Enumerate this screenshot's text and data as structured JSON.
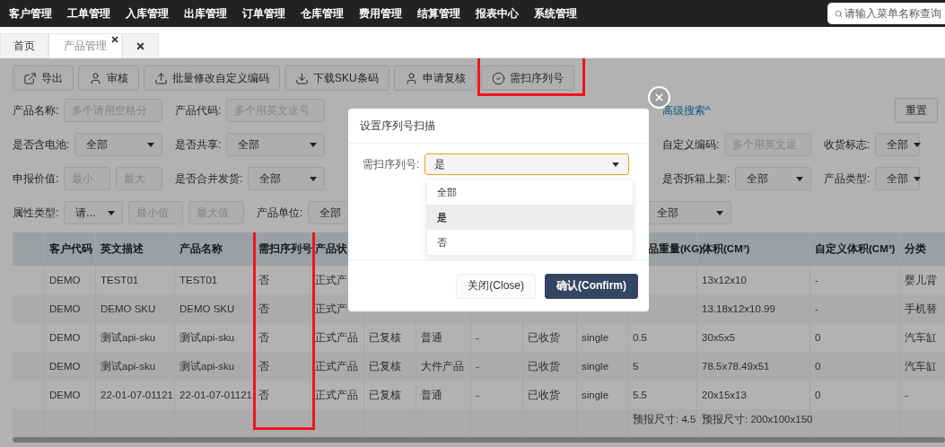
{
  "nav": {
    "items": [
      "客户管理",
      "工单管理",
      "入库管理",
      "出库管理",
      "订单管理",
      "仓库管理",
      "费用管理",
      "结算管理",
      "报表中心",
      "系统管理"
    ],
    "search": {
      "placeholder": "请输入菜单名称查询"
    }
  },
  "tabs": [
    {
      "kind": "page",
      "label": "首页",
      "selected": false,
      "closable": false
    },
    {
      "kind": "page",
      "label": "产品管理",
      "selected": true,
      "closable": true
    },
    {
      "kind": "close_all",
      "selected": false
    }
  ],
  "toolbar": [
    {
      "label": "导出",
      "highlighted": false
    },
    {
      "label": "审核",
      "highlighted": false
    },
    {
      "label": "批量修改自定义编码",
      "highlighted": false
    },
    {
      "label": "下载SKU条码",
      "highlighted": false
    },
    {
      "label": "申请复核",
      "highlighted": false
    },
    {
      "label": "需扫序列号",
      "highlighted": true
    }
  ],
  "filters": [
    [
      {
        "kind": "field",
        "label": "产品名称:",
        "controls": [
          {
            "kind": "input",
            "placeholder": "多个请用空格分"
          }
        ]
      },
      {
        "kind": "field",
        "label": "产品代码:",
        "controls": [
          {
            "kind": "input",
            "placeholder": "多个用英文逗号"
          }
        ]
      },
      {
        "kind": "link",
        "text": "高级搜索^"
      },
      {
        "kind": "button",
        "text": "重置"
      }
    ],
    [
      {
        "kind": "field",
        "label": "是否含电池:",
        "controls": [
          {
            "kind": "select",
            "value": "全部"
          }
        ]
      },
      {
        "kind": "field",
        "label": "是否共享:",
        "controls": [
          {
            "kind": "select",
            "value": "全部"
          }
        ]
      },
      {
        "kind": "field",
        "label": "自定义编码:",
        "controls": [
          {
            "kind": "input",
            "placeholder": "多个用英文逗"
          }
        ]
      },
      {
        "kind": "field",
        "label": "收货标志:",
        "controls": [
          {
            "kind": "select",
            "value": "全部"
          }
        ]
      }
    ],
    [
      {
        "kind": "field",
        "label": "申报价值:",
        "controls": [
          {
            "kind": "input",
            "placeholder": "最小"
          },
          {
            "kind": "input",
            "placeholder": "最大"
          }
        ]
      },
      {
        "kind": "field",
        "label": "是否合并发货:",
        "controls": [
          {
            "kind": "select",
            "value": "全部"
          }
        ]
      },
      {
        "kind": "field",
        "label": "是否拆箱上架:",
        "controls": [
          {
            "kind": "select",
            "value": "全部"
          }
        ]
      },
      {
        "kind": "field",
        "label": "产品类型:",
        "controls": [
          {
            "kind": "select",
            "value": "全部"
          }
        ]
      }
    ],
    [
      {
        "kind": "field",
        "label": "属性类型:",
        "controls": [
          {
            "kind": "select",
            "value": "请..."
          },
          {
            "kind": "input",
            "placeholder": "最小值"
          },
          {
            "kind": "input",
            "placeholder": "最大值"
          }
        ]
      },
      {
        "kind": "field",
        "label": "产品单位:",
        "controls": [
          {
            "kind": "select",
            "value": "全部"
          }
        ]
      },
      {
        "kind": "field",
        "controls": [
          {
            "kind": "select",
            "value": "全部"
          }
        ]
      }
    ]
  ],
  "table": {
    "columns": [
      {
        "label": "客户代码",
        "highlighted": false
      },
      {
        "label": "英文描述",
        "highlighted": false
      },
      {
        "label": "产品名称",
        "highlighted": false
      },
      {
        "label": "需扫序列号",
        "highlighted": true
      },
      {
        "label": "产品状",
        "highlighted": false
      },
      null,
      null,
      null,
      null,
      null,
      {
        "label": "品重量(KG)",
        "highlighted": false
      },
      {
        "label": "体积(CM³)",
        "highlighted": false
      },
      {
        "label": "自定义体积(CM³)",
        "highlighted": false
      },
      {
        "label": "分类",
        "highlighted": false
      }
    ],
    "rows": [
      [
        "DEMO",
        "TEST01",
        "TEST01",
        "否",
        "正式产",
        null,
        null,
        null,
        null,
        null,
        null,
        "13x12x10",
        "-",
        "婴儿背"
      ],
      [
        "DEMO",
        "DEMO SKU",
        "DEMO SKU",
        "否",
        "正式产",
        null,
        null,
        null,
        null,
        null,
        null,
        "13.18x12x10.99",
        "-",
        "手机替"
      ],
      [
        "DEMO",
        "测试api-sku",
        "测试api-sku",
        "否",
        "正式产品",
        "已复核",
        "普通",
        "-",
        "已收货",
        "single",
        "0.5",
        "30x5x5",
        "0",
        "汽车缸"
      ],
      [
        "DEMO",
        "测试api-sku",
        "测试api-sku",
        "否",
        "正式产品",
        "已复核",
        "大件产品",
        "-",
        "已收货",
        "single",
        "5",
        "78.5x78.49x51",
        "0",
        "汽车缸"
      ],
      [
        "DEMO",
        "22-01-07-01121",
        "22-01-07-01121",
        "否",
        "正式产品",
        "已复核",
        "普通",
        "-",
        "已收货",
        "single",
        "5.5",
        "20x15x13",
        "0",
        "-"
      ],
      [
        null,
        null,
        null,
        null,
        null,
        null,
        null,
        null,
        null,
        null,
        "预报尺寸: 4.5",
        "预报尺寸: 200x100x150",
        null,
        null
      ]
    ]
  },
  "dialog": {
    "title": "设置序列号扫描",
    "field": {
      "label": "需扫序列号:",
      "value": "是"
    },
    "options": [
      {
        "label": "全部",
        "selected": false
      },
      {
        "label": "是",
        "selected": true
      },
      {
        "label": "否",
        "selected": false
      }
    ],
    "buttons": [
      {
        "label": "关闭(Close)",
        "kind": "secondary"
      },
      {
        "label": "确认(Confirm)",
        "kind": "primary"
      }
    ]
  }
}
